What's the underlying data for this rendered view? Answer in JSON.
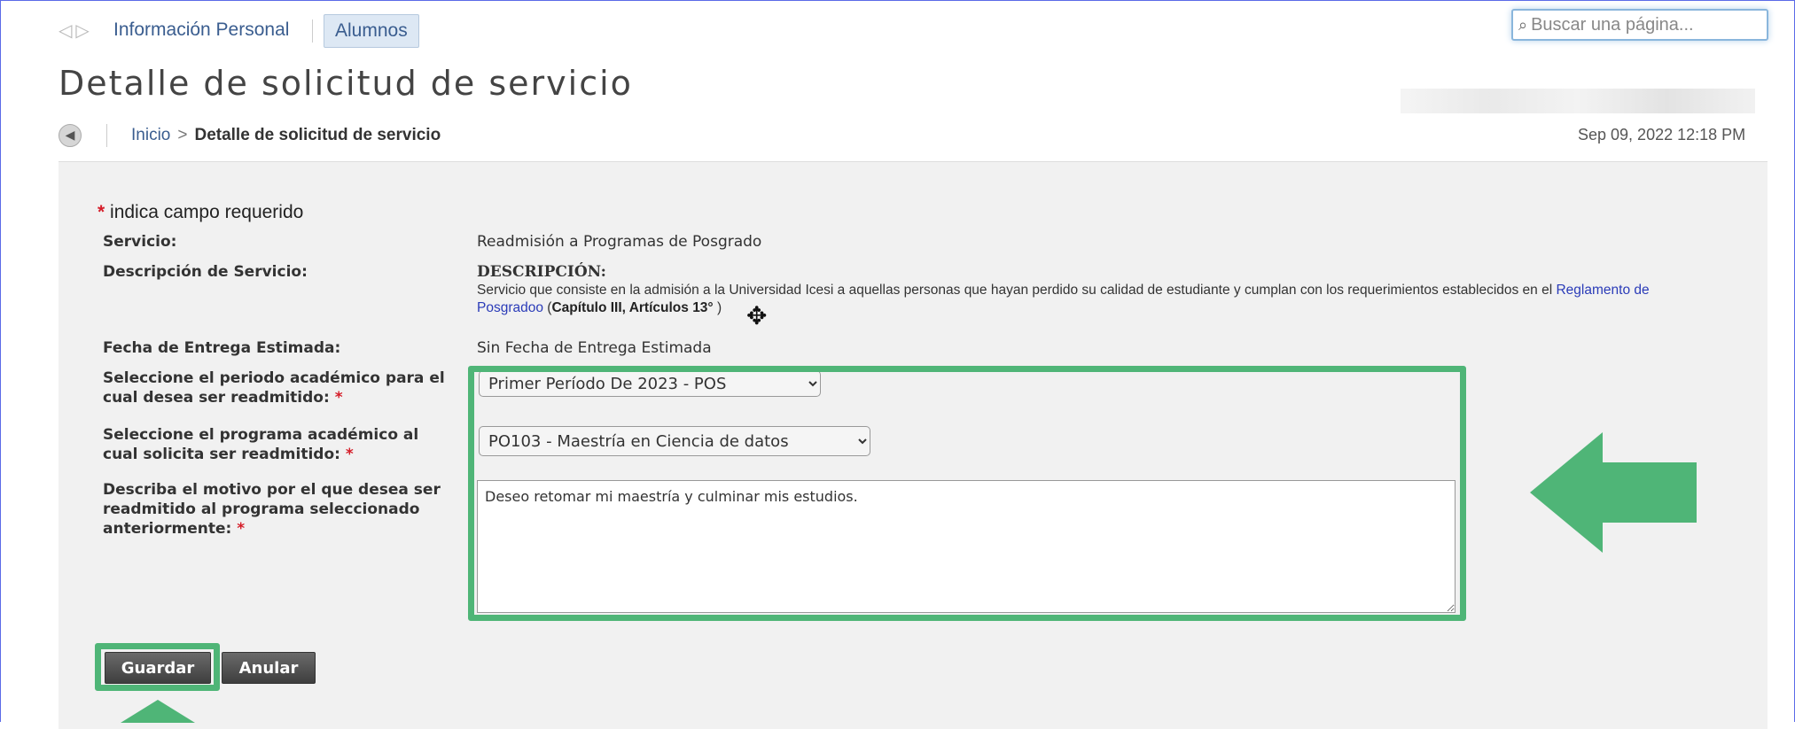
{
  "nav": {
    "tabs": [
      {
        "label": "Información Personal"
      },
      {
        "label": "Alumnos"
      }
    ]
  },
  "search": {
    "placeholder": "Buscar una página..."
  },
  "page": {
    "title": "Detalle de solicitud de servicio",
    "breadcrumb": {
      "home": "Inicio",
      "separator": ">",
      "current": "Detalle de solicitud de servicio"
    },
    "datetime": "Sep 09, 2022 12:18 PM"
  },
  "form": {
    "required_note": "indica campo requerido",
    "required_star": "*",
    "servicio_label": "Servicio:",
    "servicio_value": "Readmisión a Programas de Posgrado",
    "descripcion_label": "Descripción de Servicio:",
    "descripcion_title": "DESCRIPCIÓN:",
    "descripcion_text_1": "Servicio que consiste en la admisión a la Universidad Icesi a aquellas personas que hayan perdido su calidad de estudiante y cumplan con los requerimientos establecidos en el ",
    "descripcion_link": "Reglamento de Posgradoo",
    "descripcion_text_2": " (",
    "descripcion_bold": "Capítulo III, Artículos 13° ",
    "descripcion_text_3": ")",
    "fecha_label": "Fecha de Entrega Estimada:",
    "fecha_value": "Sin Fecha de Entrega Estimada",
    "periodo_label": "Seleccione el periodo académico para el cual desea ser readmitido:",
    "periodo_selected": "Primer Período De 2023 - POS",
    "programa_label": "Seleccione el programa académico al cual solicita ser readmitido:",
    "programa_selected": "PO103 - Maestría en Ciencia de datos",
    "motivo_label": "Describa el motivo por el que desea ser readmitido al programa seleccionado anteriormente:",
    "motivo_value": "Deseo retomar mi maestría y culminar mis estudios."
  },
  "buttons": {
    "guardar": "Guardar",
    "anular": "Anular"
  },
  "colors": {
    "highlight": "#4fb577",
    "required": "#d51d29",
    "link": "#3a5d8f"
  }
}
